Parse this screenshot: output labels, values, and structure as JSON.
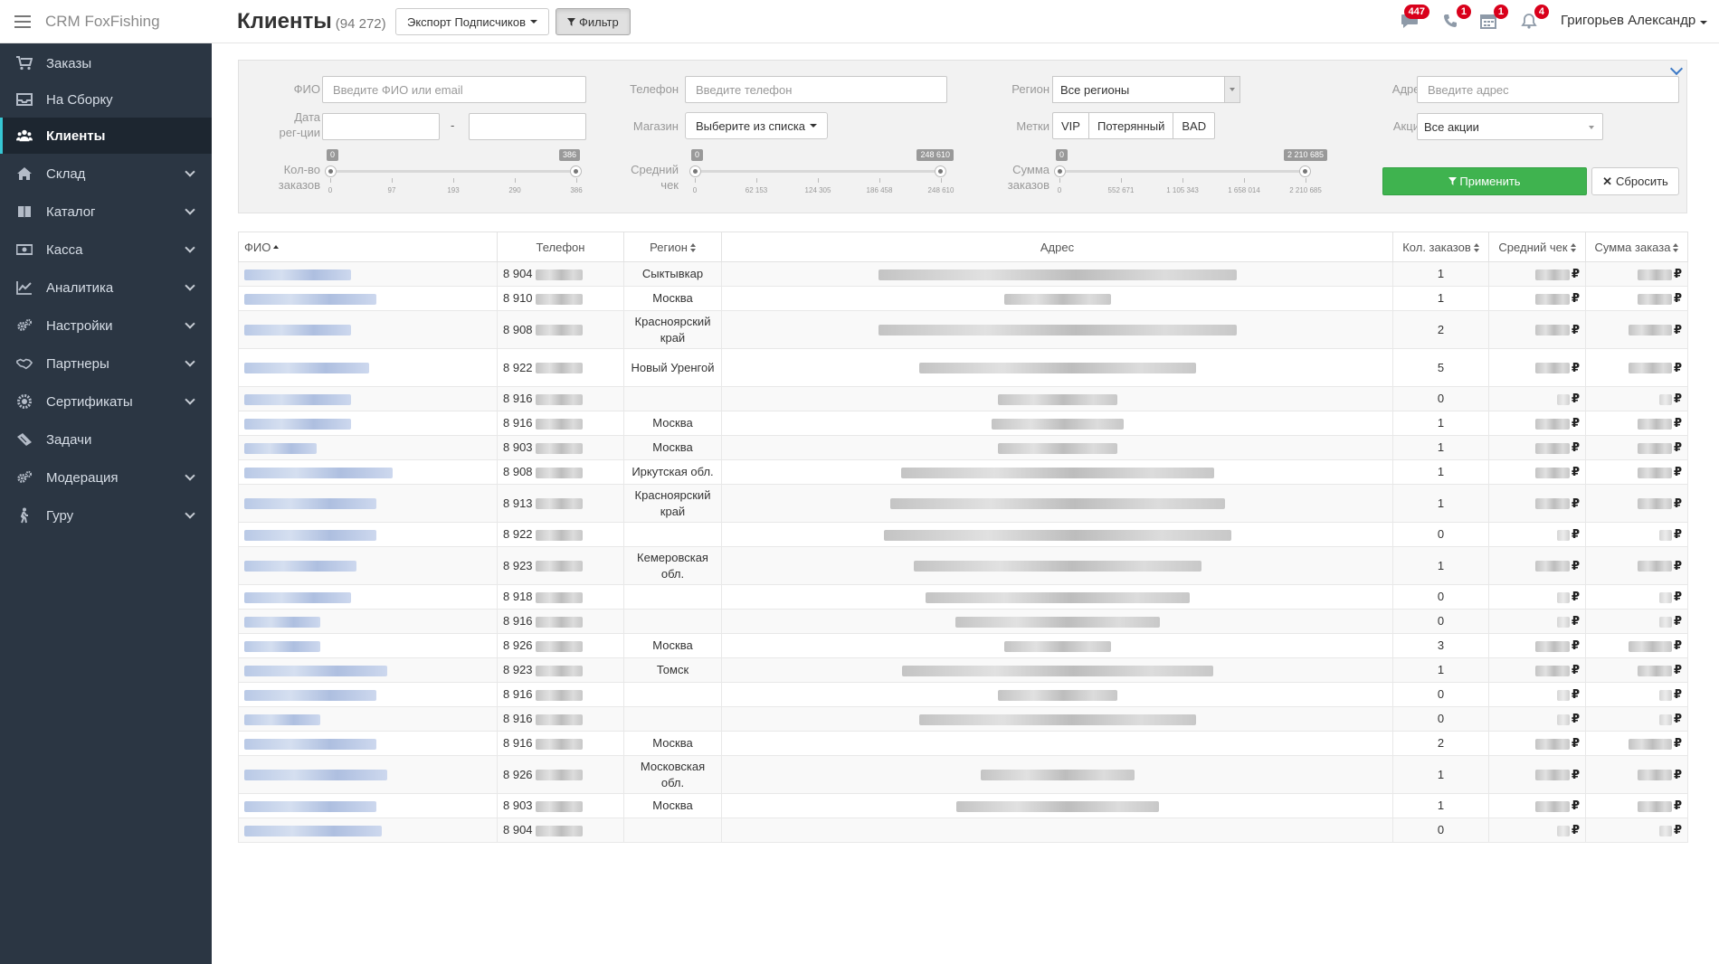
{
  "app": {
    "brand": "CRM FoxFishing"
  },
  "header": {
    "title": "Клиенты",
    "count": "(94 272)",
    "export_label": "Экспорт Подписчиков",
    "filter_label": "Фильтр",
    "notifications": [
      {
        "icon": "chat-icon",
        "count": "447"
      },
      {
        "icon": "phone-icon",
        "count": "1"
      },
      {
        "icon": "calendar-icon",
        "count": "1"
      },
      {
        "icon": "bell-icon",
        "count": "4"
      }
    ],
    "user_name": "Григорьев Александр"
  },
  "sidebar": {
    "items": [
      {
        "label": "Заказы",
        "icon": "cart-icon",
        "has_children": false,
        "active": false
      },
      {
        "label": "На Сборку",
        "icon": "inbox-icon",
        "has_children": false,
        "active": false
      },
      {
        "label": "Клиенты",
        "icon": "users-icon",
        "has_children": false,
        "active": true
      },
      {
        "label": "Склад",
        "icon": "home-icon",
        "has_children": true,
        "active": false
      },
      {
        "label": "Каталог",
        "icon": "book-icon",
        "has_children": true,
        "active": false
      },
      {
        "label": "Касса",
        "icon": "money-icon",
        "has_children": true,
        "active": false
      },
      {
        "label": "Аналитика",
        "icon": "line-chart-icon",
        "has_children": true,
        "active": false
      },
      {
        "label": "Настройки",
        "icon": "gears-icon",
        "has_children": true,
        "active": false
      },
      {
        "label": "Партнеры",
        "icon": "handshake-icon",
        "has_children": true,
        "active": false
      },
      {
        "label": "Сертификаты",
        "icon": "certificate-icon",
        "has_children": true,
        "active": false
      },
      {
        "label": "Задачи",
        "icon": "ticket-icon",
        "has_children": false,
        "active": false
      },
      {
        "label": "Модерация",
        "icon": "gears-icon",
        "has_children": true,
        "active": false
      },
      {
        "label": "Гуру",
        "icon": "walking-icon",
        "has_children": true,
        "active": false
      }
    ]
  },
  "filters": {
    "fio_label": "ФИО",
    "fio_placeholder": "Введите ФИО или email",
    "phone_label": "Телефон",
    "phone_placeholder": "Введите телефон",
    "region_label": "Регион",
    "region_value": "Все регионы",
    "address_label": "Адрес",
    "address_placeholder": "Введите адрес",
    "regdate_label_1": "Дата",
    "regdate_label_2": "рег-ции",
    "regdate_sep": "-",
    "shop_label": "Магазин",
    "shop_value": "Выберите из списка",
    "tags_label": "Метки",
    "tags": [
      "VIP",
      "Потерянный",
      "BAD"
    ],
    "promo_label": "Акция",
    "promo_value": "Все акции",
    "sliders": [
      {
        "label_1": "Кол-во",
        "label_2": "заказов",
        "min_value": "0",
        "max_value": "386",
        "ticks": [
          "0",
          "97",
          "193",
          "290",
          "386"
        ]
      },
      {
        "label_1": "Средний",
        "label_2": "чек",
        "min_value": "0",
        "max_value": "248 610",
        "ticks": [
          "0",
          "62 153",
          "124 305",
          "186 458",
          "248 610"
        ]
      },
      {
        "label_1": "Сумма",
        "label_2": "заказов",
        "min_value": "0",
        "max_value": "2 210 685",
        "ticks": [
          "0",
          "552 671",
          "1 105 343",
          "1 658 014",
          "2 210 685"
        ]
      }
    ],
    "apply_label": "Применить",
    "reset_label": "Сбросить"
  },
  "table": {
    "columns": [
      "ФИО",
      "Телефон",
      "Регион",
      "Адрес",
      "Кол. заказов",
      "Средний чек",
      "Сумма заказа"
    ],
    "currency": "₽",
    "rows": [
      {
        "phone": "8 904",
        "region": "Сыктывкар",
        "orders": "1"
      },
      {
        "phone": "8 910",
        "region": "Москва",
        "orders": "1"
      },
      {
        "phone": "8 908",
        "region": "Красноярский край",
        "orders": "2"
      },
      {
        "phone": "8 922",
        "region": "Новый Уренгой",
        "orders": "5"
      },
      {
        "phone": "8 916",
        "region": "",
        "orders": "0"
      },
      {
        "phone": "8 916",
        "region": "Москва",
        "orders": "1"
      },
      {
        "phone": "8 903",
        "region": "Москва",
        "orders": "1"
      },
      {
        "phone": "8 908",
        "region": "Иркутская обл.",
        "orders": "1"
      },
      {
        "phone": "8 913",
        "region": "Красноярский край",
        "orders": "1"
      },
      {
        "phone": "8 922",
        "region": "",
        "orders": "0"
      },
      {
        "phone": "8 923",
        "region": "Кемеровская обл.",
        "orders": "1"
      },
      {
        "phone": "8 918",
        "region": "",
        "orders": "0"
      },
      {
        "phone": "8 916",
        "region": "",
        "orders": "0"
      },
      {
        "phone": "8 926",
        "region": "Москва",
        "orders": "3"
      },
      {
        "phone": "8 923",
        "region": "Томск",
        "orders": "1"
      },
      {
        "phone": "8 916",
        "region": "",
        "orders": "0"
      },
      {
        "phone": "8 916",
        "region": "",
        "orders": "0"
      },
      {
        "phone": "8 916",
        "region": "Москва",
        "orders": "2"
      },
      {
        "phone": "8 926",
        "region": "Московская обл.",
        "orders": "1"
      },
      {
        "phone": "8 903",
        "region": "Москва",
        "orders": "1"
      },
      {
        "phone": "8 904",
        "region": "",
        "orders": "0"
      }
    ]
  }
}
